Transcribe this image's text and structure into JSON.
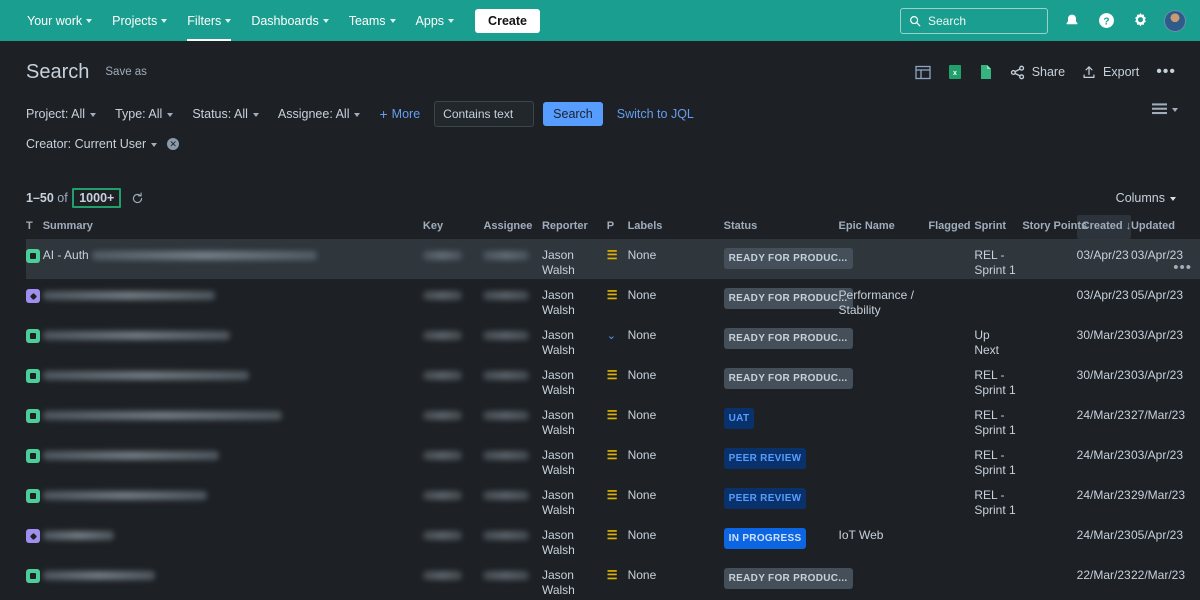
{
  "topnav": {
    "items": [
      {
        "label": "Your work",
        "caret": true,
        "active": false
      },
      {
        "label": "Projects",
        "caret": true,
        "active": false
      },
      {
        "label": "Filters",
        "caret": true,
        "active": true
      },
      {
        "label": "Dashboards",
        "caret": true,
        "active": false
      },
      {
        "label": "Teams",
        "caret": true,
        "active": false
      },
      {
        "label": "Apps",
        "caret": true,
        "active": false
      }
    ],
    "create_label": "Create",
    "search_placeholder": "Search",
    "icons": [
      "notifications-icon",
      "help-icon",
      "settings-icon",
      "avatar"
    ],
    "brand_color": "#1A9E8F"
  },
  "header": {
    "title": "Search",
    "save_as": "Save as",
    "tools": [
      {
        "name": "detail-view-icon",
        "label": ""
      },
      {
        "name": "export-excel-icon",
        "label": ""
      },
      {
        "name": "export-doc-icon",
        "label": ""
      },
      {
        "name": "share-button",
        "label": "Share"
      },
      {
        "name": "export-button",
        "label": "Export"
      },
      {
        "name": "more-actions-button",
        "label": "•••"
      }
    ]
  },
  "filters": {
    "chips": [
      {
        "label": "Project: All"
      },
      {
        "label": "Type: All"
      },
      {
        "label": "Status: All"
      },
      {
        "label": "Assignee: All"
      }
    ],
    "more_label": "More",
    "contains_value": "Contains text",
    "contains_placeholder": "Contains text",
    "search_label": "Search",
    "jql_label": "Switch to JQL",
    "creator_chip": "Creator: Current User"
  },
  "results": {
    "range": "1–50",
    "of": "of",
    "total": "1000+",
    "columns_label": "Columns"
  },
  "table": {
    "headers": [
      "T",
      "Summary",
      "Key",
      "Assignee",
      "Reporter",
      "P",
      "Labels",
      "Status",
      "Epic Name",
      "Flagged",
      "Sprint",
      "Story Points",
      "Created",
      "Updated"
    ],
    "sorted_column": "Created",
    "sort_direction": "desc",
    "rows": [
      {
        "type": "story",
        "summary": "AI - Auth",
        "key": "",
        "assignee": "",
        "reporter": "Jason Walsh",
        "priority": "medium",
        "labels": "None",
        "status": "READY FOR PRODUC...",
        "status_style": "grey",
        "epic": "",
        "flagged": "",
        "sprint": "REL - Sprint 1",
        "points": "",
        "created": "03/Apr/23",
        "updated": "03/Apr/23",
        "selected": true
      },
      {
        "type": "task",
        "summary": "",
        "key": "",
        "assignee": "",
        "reporter": "Jason Walsh",
        "priority": "medium",
        "labels": "None",
        "status": "READY FOR PRODUC...",
        "status_style": "grey",
        "epic": "Performance / Stability",
        "flagged": "",
        "sprint": "",
        "points": "",
        "created": "03/Apr/23",
        "updated": "05/Apr/23",
        "selected": false
      },
      {
        "type": "story",
        "summary": "",
        "key": "",
        "assignee": "",
        "reporter": "Jason Walsh",
        "priority": "low",
        "labels": "None",
        "status": "READY FOR PRODUC...",
        "status_style": "grey",
        "epic": "",
        "flagged": "",
        "sprint": "Up Next",
        "points": "",
        "created": "30/Mar/23",
        "updated": "03/Apr/23",
        "selected": false
      },
      {
        "type": "story",
        "summary": "",
        "key": "",
        "assignee": "",
        "reporter": "Jason Walsh",
        "priority": "medium",
        "labels": "None",
        "status": "READY FOR PRODUC...",
        "status_style": "grey",
        "epic": "",
        "flagged": "",
        "sprint": "REL - Sprint 1",
        "points": "",
        "created": "30/Mar/23",
        "updated": "03/Apr/23",
        "selected": false
      },
      {
        "type": "story",
        "summary": "",
        "key": "",
        "assignee": "",
        "reporter": "Jason Walsh",
        "priority": "medium",
        "labels": "None",
        "status": "UAT",
        "status_style": "blue",
        "epic": "",
        "flagged": "",
        "sprint": "REL - Sprint 1",
        "points": "",
        "created": "24/Mar/23",
        "updated": "27/Mar/23",
        "selected": false
      },
      {
        "type": "story",
        "summary": "",
        "key": "",
        "assignee": "Jason Walsh",
        "reporter": "Jason Walsh",
        "priority": "medium",
        "labels": "None",
        "status": "PEER REVIEW",
        "status_style": "blue",
        "epic": "",
        "flagged": "",
        "sprint": "REL - Sprint 1",
        "points": "",
        "created": "24/Mar/23",
        "updated": "03/Apr/23",
        "selected": false
      },
      {
        "type": "story",
        "summary": "",
        "key": "",
        "assignee": "Travis Bates",
        "reporter": "Jason Walsh",
        "priority": "medium",
        "labels": "None",
        "status": "PEER REVIEW",
        "status_style": "blue",
        "epic": "",
        "flagged": "",
        "sprint": "REL - Sprint 1",
        "points": "",
        "created": "24/Mar/23",
        "updated": "29/Mar/23",
        "selected": false
      },
      {
        "type": "task",
        "summary": "",
        "key": "",
        "assignee": "Walsh",
        "reporter": "Jason Walsh",
        "priority": "medium",
        "labels": "None",
        "status": "IN PROGRESS",
        "status_style": "blue2",
        "epic": "IoT Web",
        "flagged": "",
        "sprint": "",
        "points": "",
        "created": "24/Mar/23",
        "updated": "05/Apr/23",
        "selected": false
      },
      {
        "type": "story",
        "summary": "",
        "key": "",
        "assignee": "",
        "reporter": "Jason Walsh",
        "priority": "medium",
        "labels": "None",
        "status": "READY FOR PRODUC...",
        "status_style": "grey",
        "epic": "",
        "flagged": "",
        "sprint": "",
        "points": "",
        "created": "22/Mar/23",
        "updated": "22/Mar/23",
        "selected": false
      }
    ]
  }
}
